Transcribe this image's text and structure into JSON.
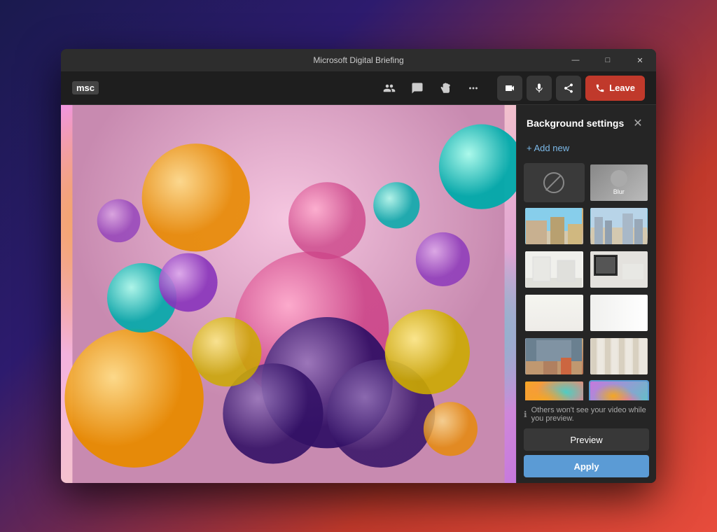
{
  "window": {
    "title": "Microsoft Digital Briefing",
    "controls": {
      "minimize": "—",
      "maximize": "□",
      "close": "✕"
    }
  },
  "toolbar": {
    "logo": "msc",
    "icons": [
      {
        "name": "people-icon",
        "symbol": "👥"
      },
      {
        "name": "chat-icon",
        "symbol": "💬"
      },
      {
        "name": "hand-icon",
        "symbol": "✋"
      },
      {
        "name": "more-icon",
        "symbol": "•••"
      }
    ],
    "call_controls": [
      {
        "name": "video-btn",
        "symbol": "📹"
      },
      {
        "name": "mic-btn",
        "symbol": "🎤"
      },
      {
        "name": "share-btn",
        "symbol": "📤"
      }
    ],
    "leave_label": "Leave"
  },
  "background_panel": {
    "title": "Background settings",
    "add_new_label": "+ Add new",
    "info_text": "Others won't see your video while you preview.",
    "preview_label": "Preview",
    "apply_label": "Apply",
    "items": [
      {
        "id": "none",
        "label": "None",
        "type": "none",
        "selected": false
      },
      {
        "id": "blur",
        "label": "Blur",
        "type": "blur",
        "selected": false
      },
      {
        "id": "office1",
        "label": "Office 1",
        "type": "office1",
        "selected": false
      },
      {
        "id": "city",
        "label": "City",
        "type": "city",
        "selected": false
      },
      {
        "id": "white-room1",
        "label": "White Room 1",
        "type": "white-room1",
        "selected": false
      },
      {
        "id": "black-frame",
        "label": "Black Frame",
        "type": "black-frame",
        "selected": false
      },
      {
        "id": "minimal1",
        "label": "Minimal 1",
        "type": "minimal1",
        "selected": false
      },
      {
        "id": "minimal2",
        "label": "Minimal 2",
        "type": "minimal2",
        "selected": false
      },
      {
        "id": "loft",
        "label": "Loft",
        "type": "loft",
        "selected": false
      },
      {
        "id": "curtain",
        "label": "Curtain",
        "type": "curtain",
        "selected": false
      },
      {
        "id": "colorful1",
        "label": "Colorful 1",
        "type": "colorful1",
        "selected": false
      },
      {
        "id": "colorful2",
        "label": "Colorful 2",
        "type": "colorful2",
        "selected": true
      }
    ]
  }
}
